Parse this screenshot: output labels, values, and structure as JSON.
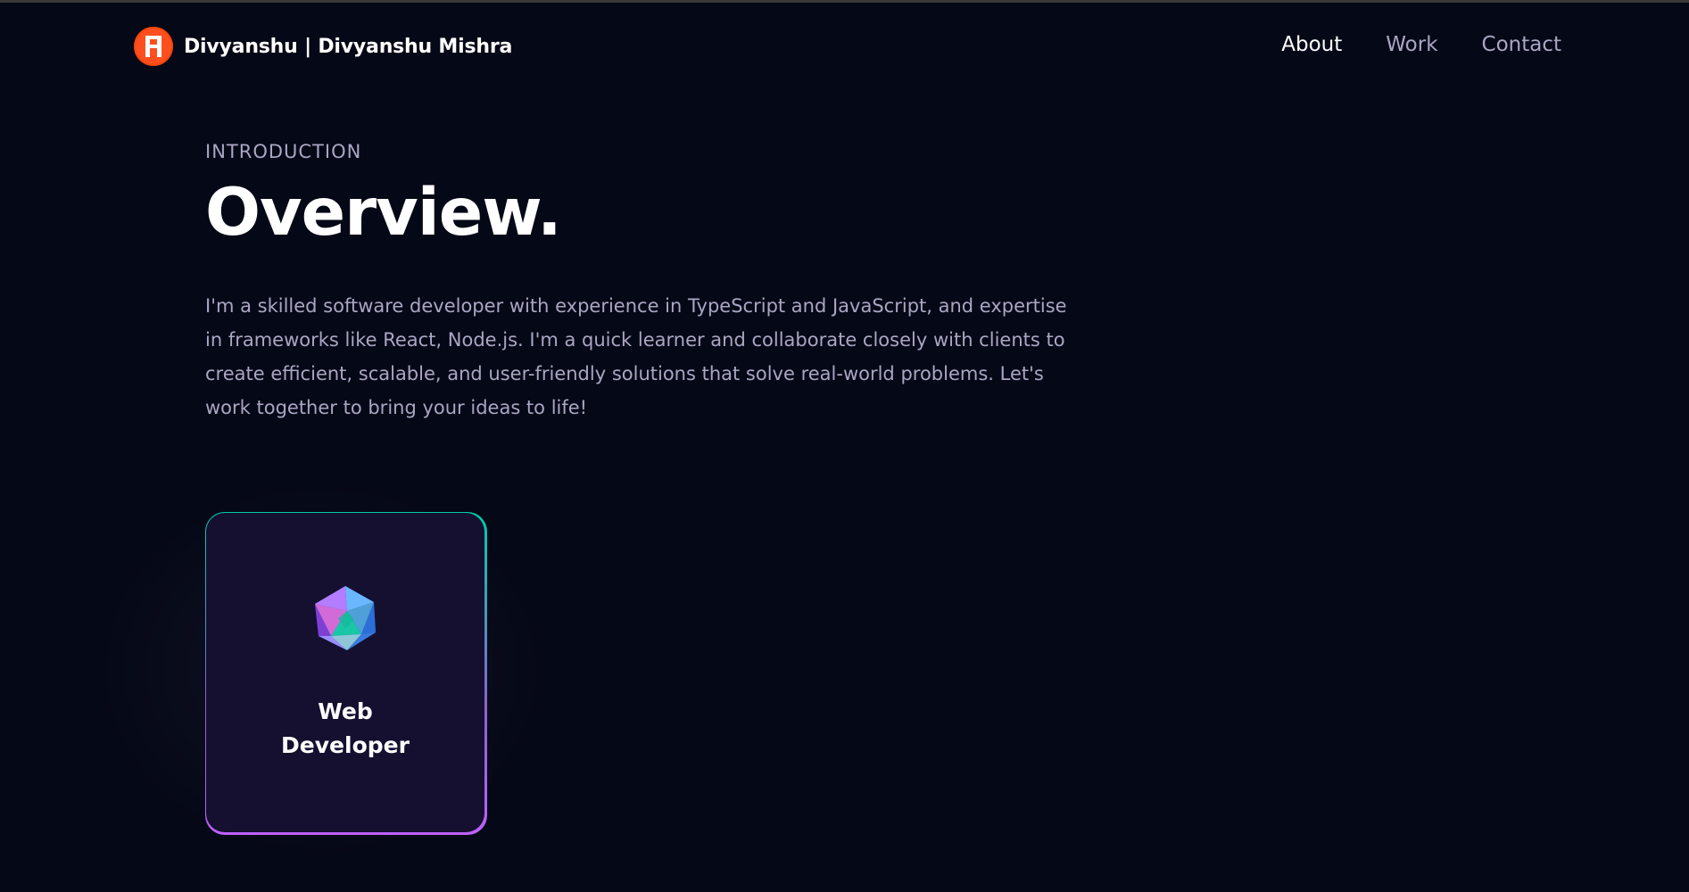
{
  "navbar": {
    "brand_name": "Divyanshu  | Divyanshu Mishra",
    "links": [
      "About",
      "Work",
      "Contact"
    ]
  },
  "overview": {
    "subtitle": "INTRODUCTION",
    "heading": "Overview.",
    "text": "I'm a skilled software developer with experience in TypeScript and JavaScript, and expertise in frameworks like React, Node.js. I'm a quick learner and collaborate closely with clients to create efficient, scalable, and user-friendly solutions that solve real-world problems. Let's work together to bring your ideas to life!"
  },
  "service_cards": [
    {
      "title_line1": "Web",
      "title_line2": "Developer",
      "icon": "polyhedron-icon"
    }
  ],
  "colors": {
    "background": "#050816",
    "secondary_text": "#aaa6c3",
    "logo": "#ff4f1f",
    "card_bg": "#151030",
    "card_border_top": "#00cea8",
    "card_border_bottom": "#bf61ff"
  }
}
